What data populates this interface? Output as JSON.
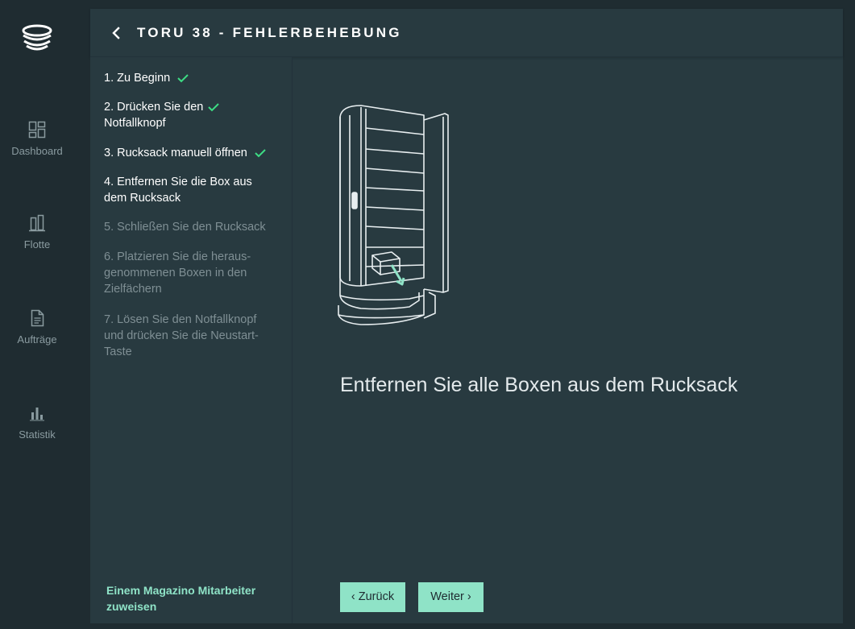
{
  "nav": {
    "items": [
      {
        "label": "Dashboard",
        "icon": "dashboard-icon"
      },
      {
        "label": "Flotte",
        "icon": "fleet-icon"
      },
      {
        "label": "Aufträge",
        "icon": "orders-icon"
      },
      {
        "label": "Statistik",
        "icon": "statistics-icon"
      }
    ]
  },
  "header": {
    "title": "TORU 38 - FEHLERBEHEBUNG"
  },
  "steps": [
    {
      "label": "1. Zu Beginn",
      "done": true
    },
    {
      "label": "2. Drücken Sie den Notfallknopf",
      "done": true
    },
    {
      "label": "3. Rucksack manuell öffnen",
      "done": true
    },
    {
      "label": "4. Entfernen Sie die Box aus dem Rucksack",
      "done": false,
      "current": true
    },
    {
      "label": "5. Schließen Sie den Rucksack",
      "done": false
    },
    {
      "label": "6. Platzieren Sie die heraus-genommenen Boxen in den Zielfächern",
      "done": false
    },
    {
      "label": "7. Lösen Sie den Notfallknopf und drücken Sie die Neustart-Taste",
      "done": false
    }
  ],
  "assign_link": "Einem Magazino Mitarbeiter zuweisen",
  "instruction": "Entfernen Sie alle Boxen aus dem Rucksack",
  "buttons": {
    "back": "Zurück",
    "next": "Weiter"
  },
  "colors": {
    "accent": "#8fe3c7",
    "check": "#3ddc84",
    "background": "#1f2c31",
    "panel": "#283a40"
  }
}
